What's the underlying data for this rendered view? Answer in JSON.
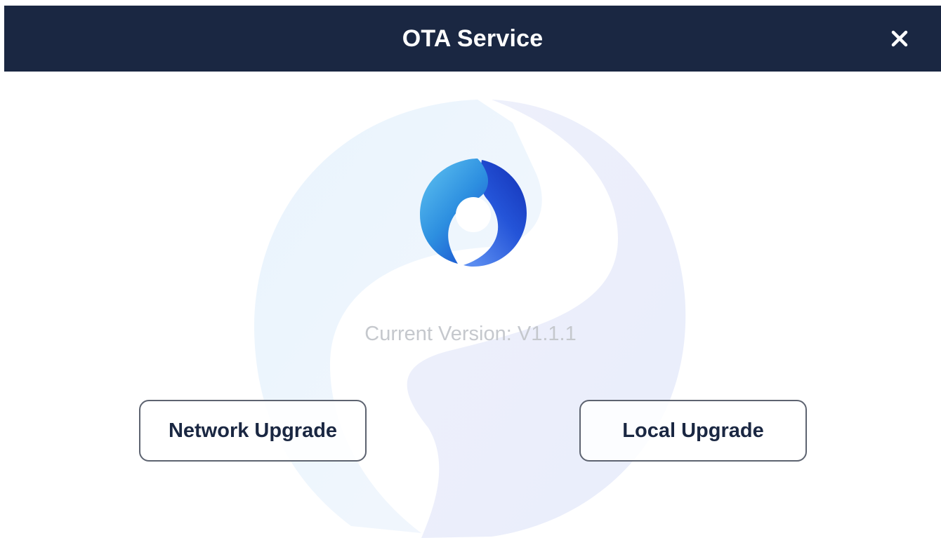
{
  "header": {
    "title": "OTA Service",
    "close_icon": "close-icon"
  },
  "main": {
    "logo_icon": "ota-refresh-logo-icon",
    "version_text": "Current Version: V1.1.1",
    "buttons": {
      "network_upgrade_label": "Network Upgrade",
      "local_upgrade_label": "Local Upgrade"
    }
  },
  "colors": {
    "header_bg": "#1a2742",
    "header_text": "#ffffff",
    "button_border": "#5d6370",
    "button_text": "#1a2742",
    "version_text": "#c5c8cd",
    "logo_light_blue": "#4fb6ee",
    "logo_dark_blue": "#1d3fc4"
  }
}
